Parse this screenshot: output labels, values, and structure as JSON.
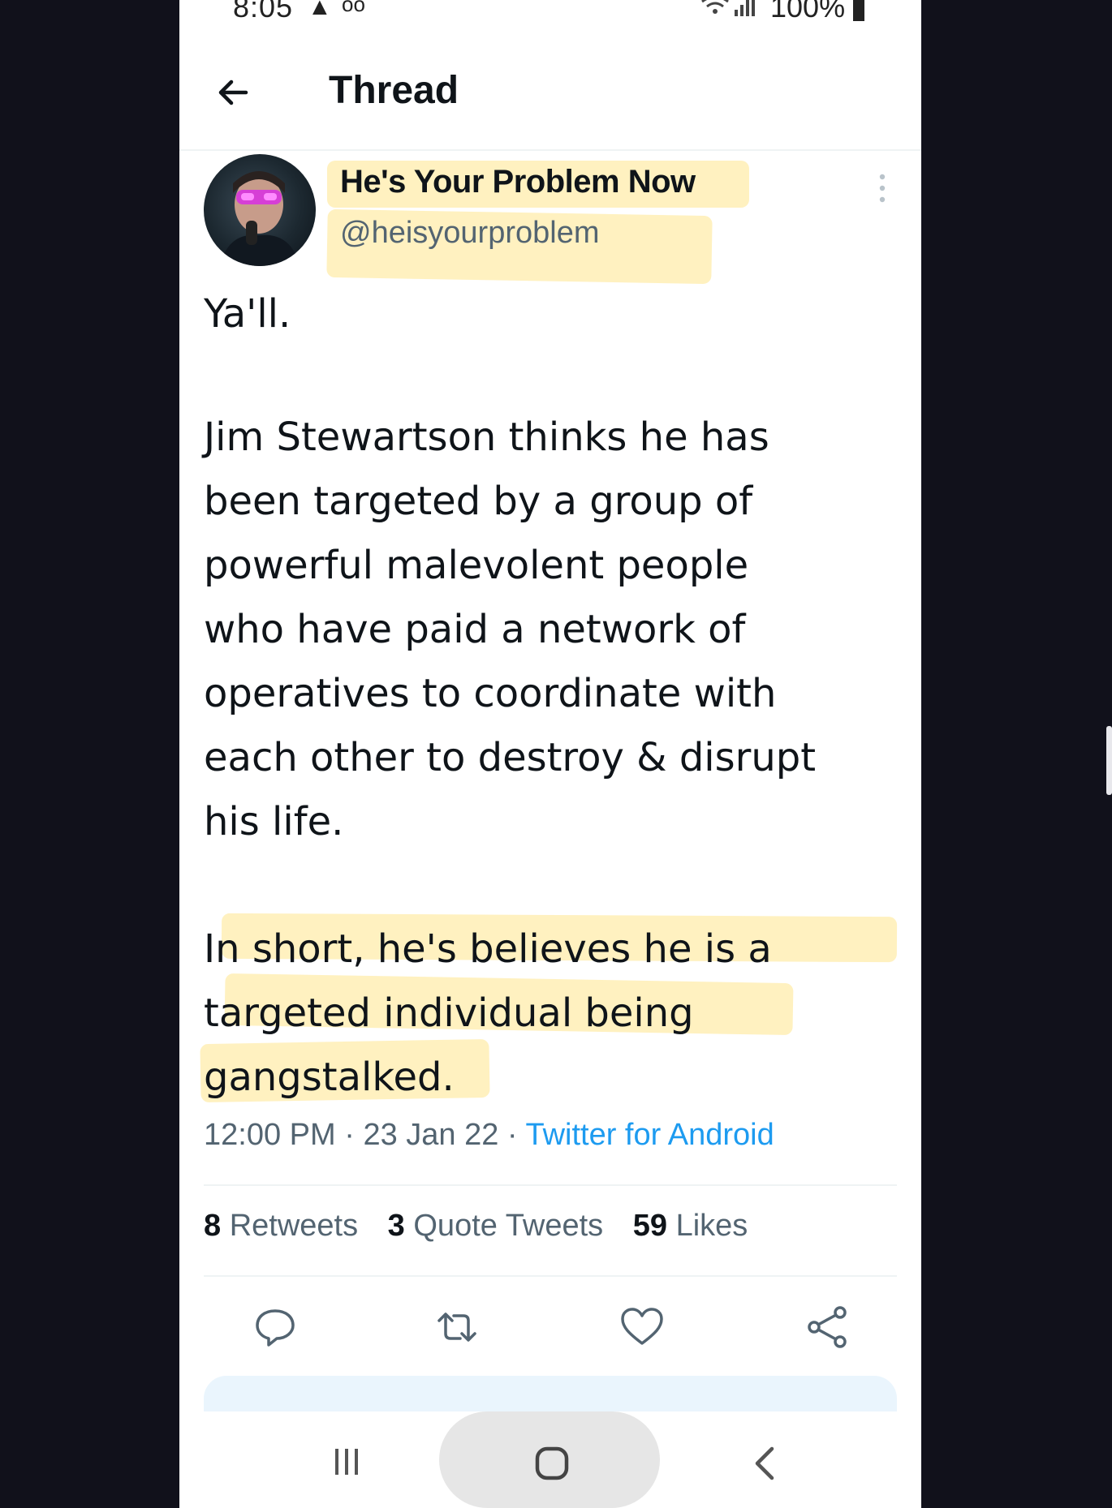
{
  "status_bar": {
    "time": "8:05",
    "battery": "100%",
    "icons": [
      "alert-icon",
      "voicemail-icon",
      "wifi-icon",
      "signal-icon",
      "battery-icon"
    ]
  },
  "header": {
    "title": "Thread",
    "back_icon": "back-arrow-icon"
  },
  "tweet": {
    "display_name": "He's Your Problem Now",
    "handle": "@heisyourproblem",
    "paragraphs": [
      "Ya'll.",
      "Jim Stewartson thinks he has\nbeen targeted by a group of\npowerful malevolent people\nwho have paid a network of\noperatives to coordinate with\neach other to destroy & disrupt\nhis life.",
      "In short, he's believes he is a\ntargeted individual being\ngangstalked."
    ],
    "time": "12:00 PM",
    "date": "23 Jan 22",
    "source": "Twitter for Android",
    "stats": {
      "retweets_count": "8",
      "retweets_label": "Retweets",
      "quotes_count": "3",
      "quotes_label": "Quote Tweets",
      "likes_count": "59",
      "likes_label": "Likes"
    },
    "actions": [
      "reply-icon",
      "retweet-icon",
      "like-icon",
      "share-icon"
    ]
  },
  "colors": {
    "text": "#0f1419",
    "secondary": "#536471",
    "link": "#1d9bf0",
    "highlight": "#ffe68c",
    "background_outside": "#11111b"
  },
  "nav_bar": {
    "icons": [
      "recent-apps-icon",
      "home-icon",
      "back-icon"
    ]
  }
}
